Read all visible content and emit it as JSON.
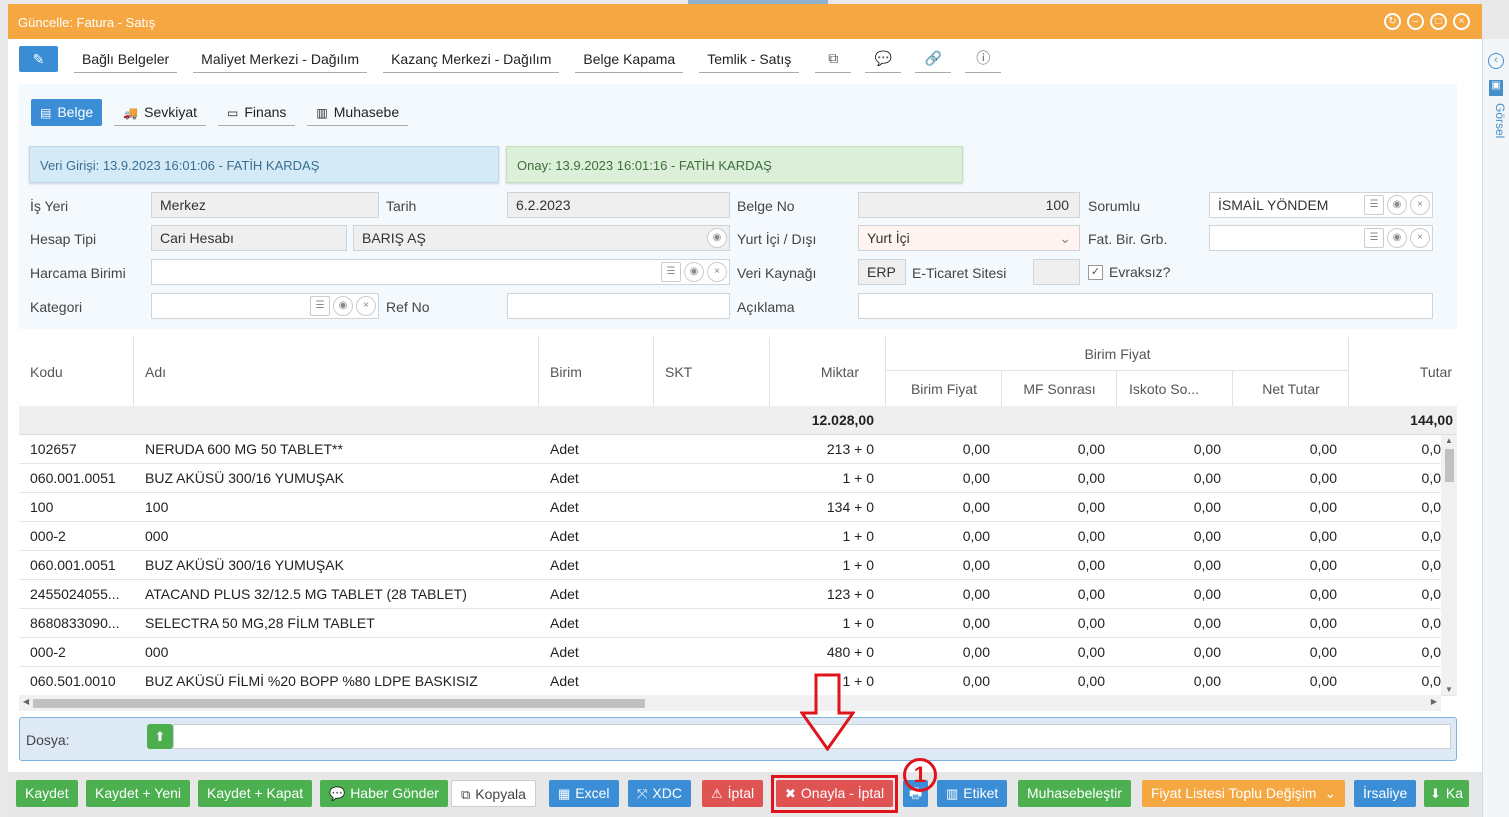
{
  "window": {
    "title": "Güncelle: Fatura - Satış"
  },
  "toolbar": {
    "links": [
      "Bağlı Belgeler",
      "Maliyet Merkezi - Dağılım",
      "Kazanç Merkezi - Dağılım",
      "Belge Kapama",
      "Temlik - Satış"
    ],
    "icons": [
      "copy-icon",
      "chat-icon",
      "link-icon",
      "info-icon"
    ]
  },
  "side": {
    "label": "Görsel"
  },
  "tabs": [
    {
      "label": "Belge",
      "icon": "document-icon",
      "active": true
    },
    {
      "label": "Sevkiyat",
      "icon": "truck-icon",
      "active": false
    },
    {
      "label": "Finans",
      "icon": "money-icon",
      "active": false
    },
    {
      "label": "Muhasebe",
      "icon": "book-icon",
      "active": false
    }
  ],
  "audit": {
    "entry": "Veri Girişi: 13.9.2023 16:01:06 - FATİH KARDAŞ",
    "approve": "Onay: 13.9.2023 16:01:16 - FATİH KARDAŞ"
  },
  "form": {
    "is_yeri_label": "İş Yeri",
    "is_yeri": "Merkez",
    "tarih_label": "Tarih",
    "tarih": "6.2.2023",
    "belge_no_label": "Belge No",
    "belge_no": "100",
    "sorumlu_label": "Sorumlu",
    "sorumlu": "İSMAİL YÖNDEM",
    "hesap_tipi_label": "Hesap Tipi",
    "hesap_tipi": "Cari Hesabı",
    "hesap": "BARIŞ AŞ",
    "yurt_label": "Yurt İçi / Dışı",
    "yurt": "Yurt İçi",
    "fat_label": "Fat. Bir. Grb.",
    "fat": "",
    "harcama_label": "Harcama Birimi",
    "harcama": "",
    "veri_kaynagi_label": "Veri Kaynağı",
    "veri_kaynagi": "ERP",
    "eticaret_label": "E-Ticaret Sitesi",
    "eticaret": "",
    "evraksiz_label": "Evraksız?",
    "evraksiz": true,
    "kategori_label": "Kategori",
    "kategori": "",
    "ref_label": "Ref No",
    "ref": "",
    "aciklama_label": "Açıklama",
    "aciklama": ""
  },
  "grid": {
    "headers": {
      "kodu": "Kodu",
      "adi": "Adı",
      "birim": "Birim",
      "skt": "SKT",
      "miktar": "Miktar",
      "birim_fiyat_group": "Birim Fiyat",
      "birim_fiyat": "Birim Fiyat",
      "mf": "MF Sonrası",
      "iskonto": "Iskoto So...",
      "net": "Net Tutar",
      "tutar": "Tutar"
    },
    "totals": {
      "miktar": "12.028,00",
      "tutar": "144,00"
    },
    "rows": [
      {
        "kodu": "102657",
        "adi": "NERUDA 600 MG 50 TABLET**",
        "birim": "Adet",
        "skt": "",
        "miktar": "213 + 0",
        "bf": "0,00",
        "mf": "0,00",
        "isk": "0,00",
        "net": "0,00",
        "tutar": "0,0"
      },
      {
        "kodu": "060.001.0051",
        "adi": "BUZ AKÜSÜ 300/16 YUMUŞAK",
        "birim": "Adet",
        "skt": "",
        "miktar": "1 + 0",
        "bf": "0,00",
        "mf": "0,00",
        "isk": "0,00",
        "net": "0,00",
        "tutar": "0,0"
      },
      {
        "kodu": "100",
        "adi": "100",
        "birim": "Adet",
        "skt": "",
        "miktar": "134 + 0",
        "bf": "0,00",
        "mf": "0,00",
        "isk": "0,00",
        "net": "0,00",
        "tutar": "0,0"
      },
      {
        "kodu": "000-2",
        "adi": "000",
        "birim": "Adet",
        "skt": "",
        "miktar": "1 + 0",
        "bf": "0,00",
        "mf": "0,00",
        "isk": "0,00",
        "net": "0,00",
        "tutar": "0,0"
      },
      {
        "kodu": "060.001.0051",
        "adi": "BUZ AKÜSÜ 300/16 YUMUŞAK",
        "birim": "Adet",
        "skt": "",
        "miktar": "1 + 0",
        "bf": "0,00",
        "mf": "0,00",
        "isk": "0,00",
        "net": "0,00",
        "tutar": "0,0"
      },
      {
        "kodu": "2455024055...",
        "adi": "ATACAND PLUS 32/12.5 MG TABLET (28 TABLET)",
        "birim": "Adet",
        "skt": "",
        "miktar": "123 + 0",
        "bf": "0,00",
        "mf": "0,00",
        "isk": "0,00",
        "net": "0,00",
        "tutar": "0,0"
      },
      {
        "kodu": "8680833090...",
        "adi": "SELECTRA 50 MG,28 FİLM TABLET",
        "birim": "Adet",
        "skt": "",
        "miktar": "1 + 0",
        "bf": "0,00",
        "mf": "0,00",
        "isk": "0,00",
        "net": "0,00",
        "tutar": "0,0"
      },
      {
        "kodu": "000-2",
        "adi": "000",
        "birim": "Adet",
        "skt": "",
        "miktar": "480 + 0",
        "bf": "0,00",
        "mf": "0,00",
        "isk": "0,00",
        "net": "0,00",
        "tutar": "0,0"
      },
      {
        "kodu": "060.501.0010",
        "adi": "BUZ AKÜSÜ FİLMİ %20 BOPP %80 LDPE BASKISIZ",
        "birim": "Adet",
        "skt": "",
        "miktar": "1 + 0",
        "bf": "0,00",
        "mf": "0,00",
        "isk": "0,00",
        "net": "0,00",
        "tutar": "0,0"
      }
    ]
  },
  "dosya": {
    "label": "Dosya:"
  },
  "actions": {
    "kaydet": "Kaydet",
    "kaydet_yeni": "Kaydet + Yeni",
    "kaydet_kapat": "Kaydet + Kapat",
    "haber": "Haber Gönder",
    "kopyala": "Kopyala",
    "excel": "Excel",
    "xdc": "XDC",
    "iptal": "İptal",
    "onayla_iptal": "Onayla - İptal",
    "etiket": "Etiket",
    "muhasebe": "Muhasebeleştir",
    "fiyat": "Fiyat Listesi Toplu Değişim",
    "irsaliye": "İrsaliye",
    "ka": "Ka"
  },
  "annotation": {
    "step": "1",
    "color": "#e0141b"
  },
  "colors": {
    "title": "#f5a742",
    "primary": "#3b8ed6",
    "success": "#4caf50",
    "danger": "#e05353"
  }
}
